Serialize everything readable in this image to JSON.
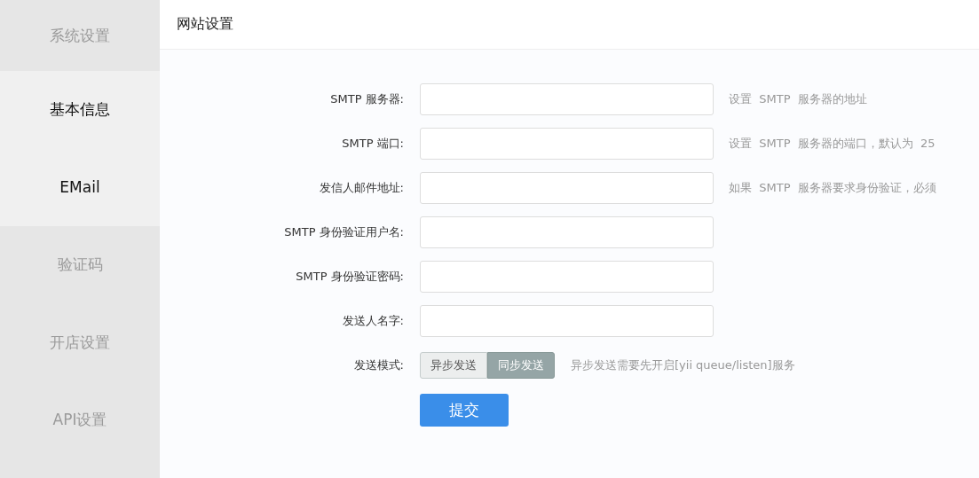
{
  "sidebar": {
    "items": [
      {
        "label": "系统设置",
        "highlighted": false
      },
      {
        "label": "基本信息",
        "highlighted": true
      },
      {
        "label": "EMail",
        "highlighted": true
      },
      {
        "label": "验证码",
        "highlighted": false
      },
      {
        "label": "开店设置",
        "highlighted": false
      },
      {
        "label": "API设置",
        "highlighted": false
      }
    ]
  },
  "header": {
    "title": "网站设置"
  },
  "form": {
    "fields": [
      {
        "label": "SMTP 服务器:",
        "hint": "设置  SMTP  服务器的地址"
      },
      {
        "label": "SMTP 端口:",
        "hint": "设置  SMTP  服务器的端口，默认为  25"
      },
      {
        "label": "发信人邮件地址:",
        "hint": "如果  SMTP  服务器要求身份验证，必须"
      },
      {
        "label": "SMTP 身份验证用户名:"
      },
      {
        "label": "SMTP 身份验证密码:"
      },
      {
        "label": "发送人名字:"
      }
    ],
    "mode": {
      "label": "发送模式:",
      "options": [
        {
          "label": "异步发送",
          "selected": false
        },
        {
          "label": "同步发送",
          "selected": true
        }
      ],
      "hint": "异步发送需要先开启[yii queue/listen]服务"
    },
    "submit": "提交"
  }
}
